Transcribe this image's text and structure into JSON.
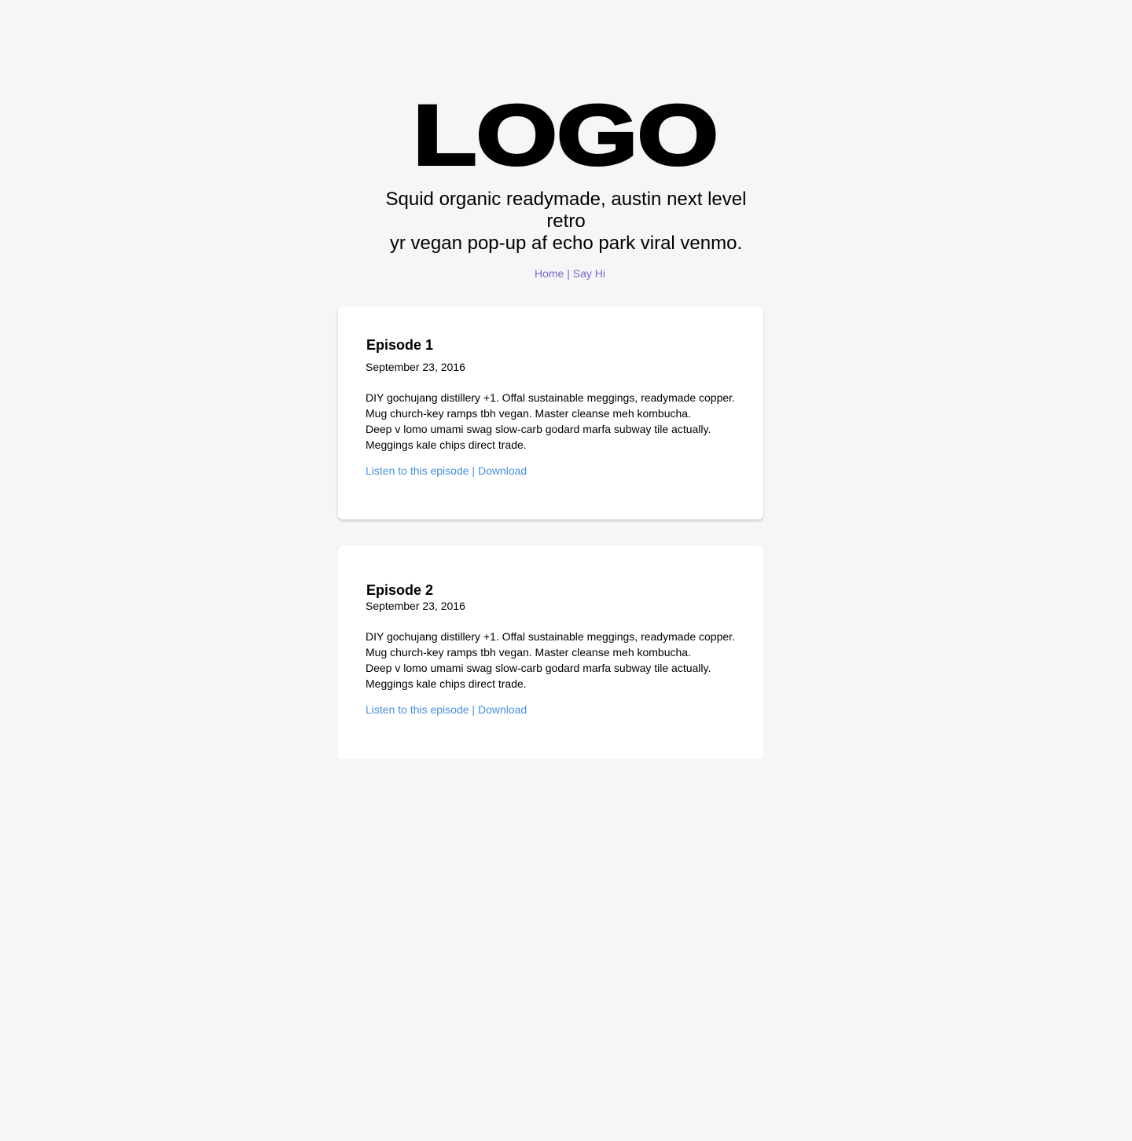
{
  "header": {
    "logo": "LOGO",
    "tagline_line1": "Squid organic readymade, austin next level retro",
    "tagline_line2": "yr vegan pop-up af echo park viral venmo."
  },
  "nav": {
    "home": "Home",
    "separator": "|",
    "say_hi": "Say Hi"
  },
  "colors": {
    "background": "#f5f6f8",
    "nav_link": "#7a67c7",
    "episode_link": "#4a90d9"
  },
  "episodes": [
    {
      "title": "Episode 1",
      "date": "September 23, 2016",
      "description": [
        "DIY gochujang distillery +1. Offal sustainable meggings, readymade copper.",
        "Mug church-key ramps tbh vegan. Master cleanse meh kombucha.",
        "Deep v lomo umami swag slow-carb godard marfa subway tile actually.",
        "Meggings kale chips direct trade."
      ],
      "listen_label": "Listen to this episode",
      "separator": "|",
      "download_label": "Download"
    },
    {
      "title": "Episode 2",
      "date": "September 23, 2016",
      "description": [
        "DIY gochujang distillery +1. Offal sustainable meggings, readymade copper.",
        "Mug church-key ramps tbh vegan. Master cleanse meh kombucha.",
        "Deep v lomo umami swag slow-carb godard marfa subway tile actually.",
        "Meggings kale chips direct trade."
      ],
      "listen_label": "Listen to this episode",
      "separator": "|",
      "download_label": "Download"
    }
  ]
}
